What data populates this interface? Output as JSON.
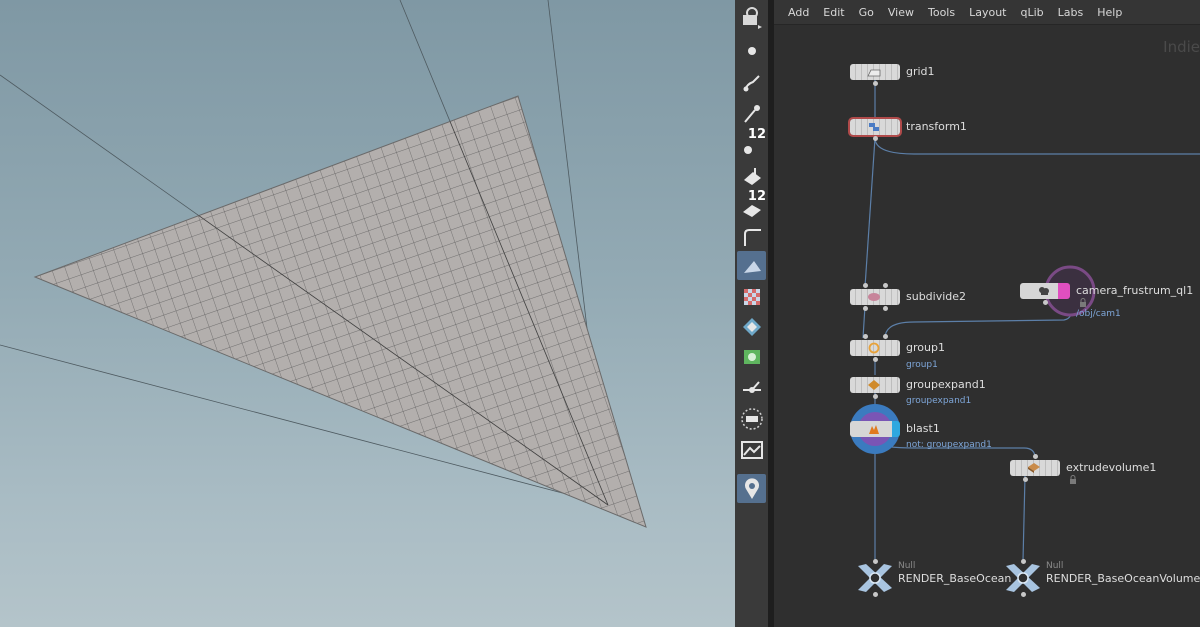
{
  "menubar": {
    "items": [
      "Add",
      "Edit",
      "Go",
      "View",
      "Tools",
      "Layout",
      "qLib",
      "Labs",
      "Help"
    ]
  },
  "network": {
    "watermark": "Indie",
    "nodes": {
      "grid1": {
        "label": "grid1"
      },
      "transform1": {
        "label": "transform1"
      },
      "subdivide2": {
        "label": "subdivide2"
      },
      "camera": {
        "label": "camera_frustrum_ql1",
        "sub": "/obj/cam1"
      },
      "group1": {
        "label": "group1",
        "sub": "group1"
      },
      "groupexpand1": {
        "label": "groupexpand1",
        "sub": "groupexpand1"
      },
      "blast1": {
        "label": "blast1",
        "sub": "not: groupexpand1"
      },
      "extrudevolume1": {
        "label": "extrudevolume1"
      },
      "render1": {
        "type": "Null",
        "label": "RENDER_BaseOcean"
      },
      "render2": {
        "type": "Null",
        "label": "RENDER_BaseOceanVolume"
      }
    }
  },
  "toolbar": {
    "badges": {
      "points": "12",
      "poly": "12"
    },
    "icons": [
      "view-handle-icon",
      "point-icon",
      "brush-icon",
      "pin-icon",
      "points-12-icon",
      "primitive-icon",
      "poly-12-icon",
      "edge-icon",
      "select-face-icon",
      "checker-icon",
      "visibility-icon",
      "uv-icon",
      "pivot-icon",
      "snap-icon",
      "display-icon",
      "pin-marker-icon"
    ]
  },
  "colors": {
    "viewport_top": "#7f98a4",
    "grid_fill": "#b3afad",
    "wire": "#5c7fa8",
    "blast_accent": "#3b7bbf"
  }
}
